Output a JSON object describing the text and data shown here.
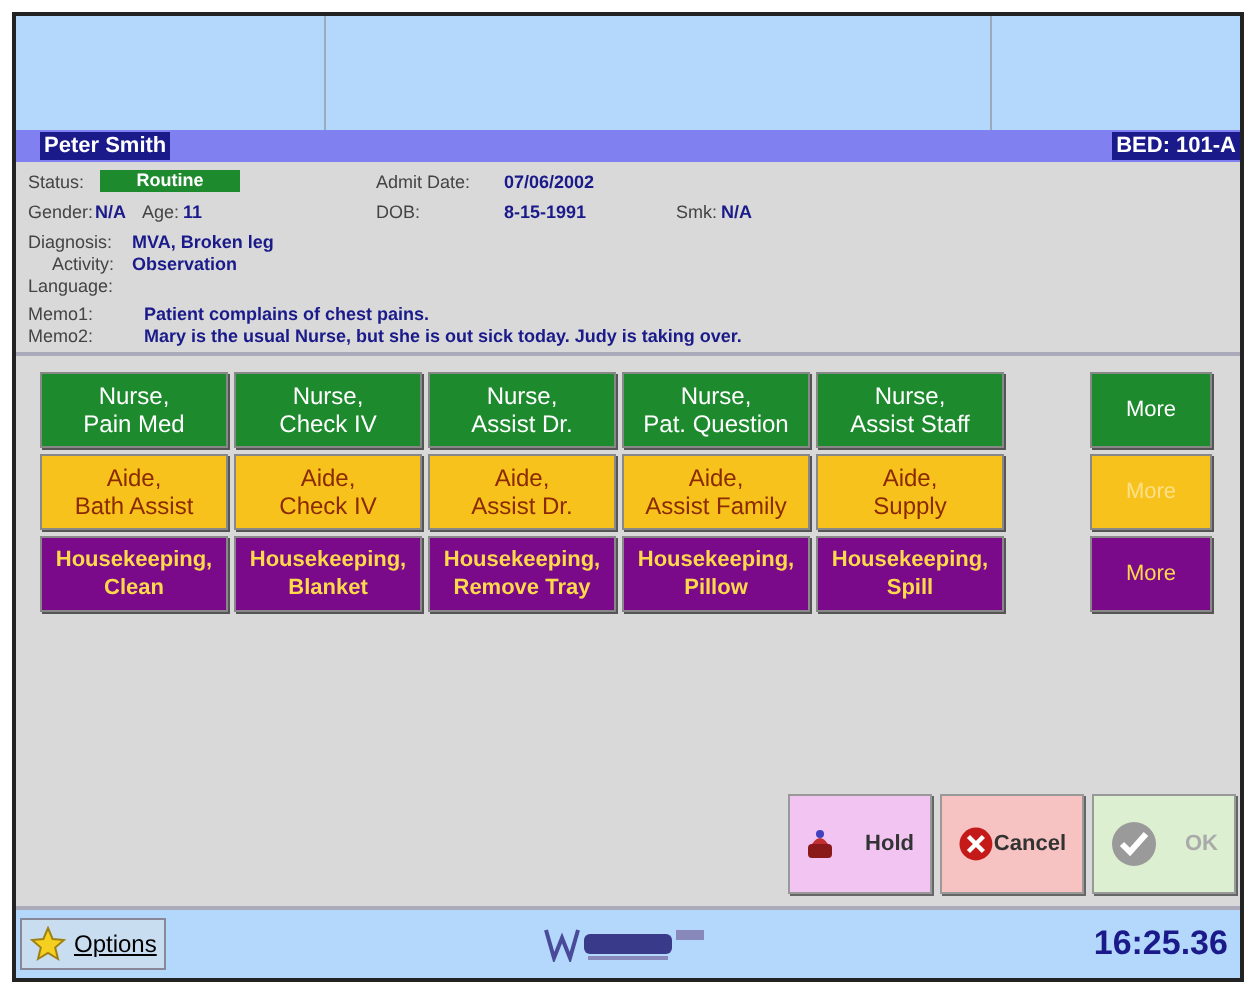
{
  "patient": {
    "name": "Peter Smith",
    "bed": "BED: 101-A"
  },
  "info": {
    "status_label": "Status:",
    "status": "Routine",
    "admit_label": "Admit Date:",
    "admit_date": "07/06/2002",
    "gender_label": "Gender:",
    "gender": "N/A",
    "age_label": "Age:",
    "age": "11",
    "dob_label": "DOB:",
    "dob": "8-15-1991",
    "smk_label": "Smk:",
    "smk": "N/A",
    "diagnosis_label": "Diagnosis:",
    "diagnosis": "MVA, Broken leg",
    "activity_label": "Activity:",
    "activity": "Observation",
    "language_label": "Language:"
  },
  "memos": [
    {
      "label": "Memo1:",
      "text": "Patient complains of chest pains."
    },
    {
      "label": "Memo2:",
      "text": "Mary is the usual Nurse, but she is out sick today. Judy is taking over."
    }
  ],
  "request_rows": [
    {
      "kind": "nurse",
      "buttons": [
        "Nurse,\nPain Med",
        "Nurse,\nCheck IV",
        "Nurse,\nAssist Dr.",
        "Nurse,\nPat. Question",
        "Nurse,\nAssist Staff"
      ],
      "more": {
        "label": "More",
        "disabled": false
      }
    },
    {
      "kind": "aide",
      "buttons": [
        "Aide,\nBath Assist",
        "Aide,\nCheck IV",
        "Aide,\nAssist Dr.",
        "Aide,\nAssist Family",
        "Aide,\nSupply"
      ],
      "more": {
        "label": "More",
        "disabled": true
      }
    },
    {
      "kind": "housekeeping",
      "buttons": [
        "Housekeeping,\nClean",
        "Housekeeping,\nBlanket",
        "Housekeeping,\nRemove Tray",
        "Housekeeping,\nPillow",
        "Housekeeping,\nSpill"
      ],
      "more": {
        "label": "More",
        "disabled": false
      }
    }
  ],
  "actions": [
    {
      "kind": "hold",
      "label": "Hold",
      "disabled": false
    },
    {
      "kind": "cancel",
      "label": "Cancel",
      "disabled": false
    },
    {
      "kind": "ok",
      "label": "OK",
      "disabled": true
    }
  ],
  "status_bar": {
    "options": "Options",
    "time": "16:25.36"
  }
}
